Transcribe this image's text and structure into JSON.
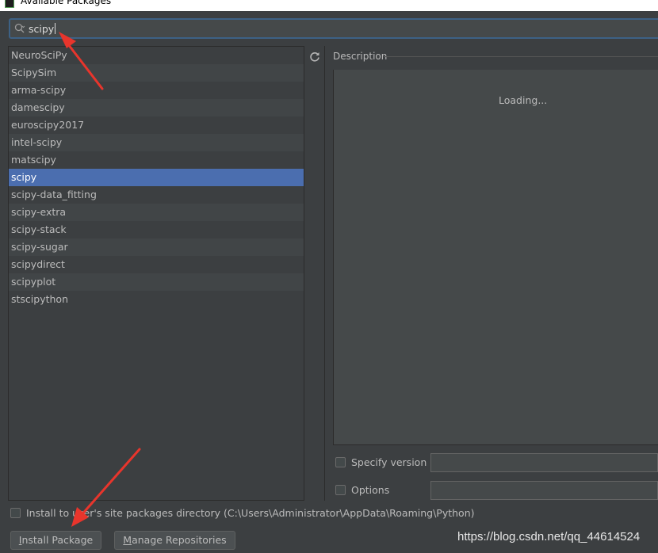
{
  "window": {
    "title": "Available Packages"
  },
  "search": {
    "value": "scipy"
  },
  "packages": [
    "NeuroSciPy",
    "ScipySim",
    "arma-scipy",
    "damescipy",
    "euroscipy2017",
    "intel-scipy",
    "matscipy",
    "scipy",
    "scipy-data_fitting",
    "scipy-extra",
    "scipy-stack",
    "scipy-sugar",
    "scipydirect",
    "scipyplot",
    "stscipython"
  ],
  "selected_package": "scipy",
  "description": {
    "label": "Description",
    "status": "Loading..."
  },
  "options": {
    "specify_version_label": "Specify version",
    "specify_version_value": "",
    "options_label": "Options",
    "options_value": ""
  },
  "install_to_user": {
    "label": "Install to user's site packages directory (C:\\Users\\Administrator\\AppData\\Roaming\\Python)"
  },
  "buttons": {
    "install_prefix": "I",
    "install_rest": "nstall Package",
    "manage_prefix": "M",
    "manage_rest": "anage Repositories"
  },
  "watermark": "https://blog.csdn.net/qq_44614524",
  "colors": {
    "background": "#3c3f41",
    "selection": "#4b6eaf",
    "search_border": "#3d6185",
    "annotation_arrow": "#e8352c"
  }
}
